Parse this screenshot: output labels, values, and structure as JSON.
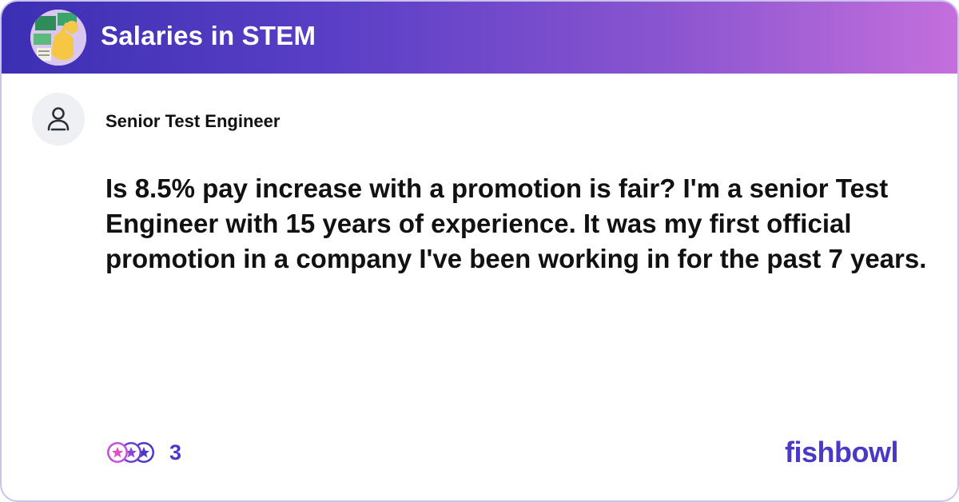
{
  "header": {
    "bowl_name": "Salaries in STEM",
    "bowl_icon": "bowl-avatar-icon"
  },
  "post": {
    "author_title": "Senior Test Engineer",
    "author_icon": "person-icon",
    "text": "Is 8.5% pay increase with a promotion is fair? I'm a senior Test Engineer with 15 years of experience. It was my first official promotion in a company I've been working in for the past 7 years."
  },
  "footer": {
    "reaction_count": "3",
    "reaction_icons": [
      "heart-star-icon",
      "star-icon",
      "star-icon"
    ],
    "brand": "fishbowl"
  },
  "colors": {
    "header_gradient_start": "#3c2fb3",
    "header_gradient_end": "#c46fdc",
    "brand": "#4a39c9",
    "text": "#111111"
  }
}
